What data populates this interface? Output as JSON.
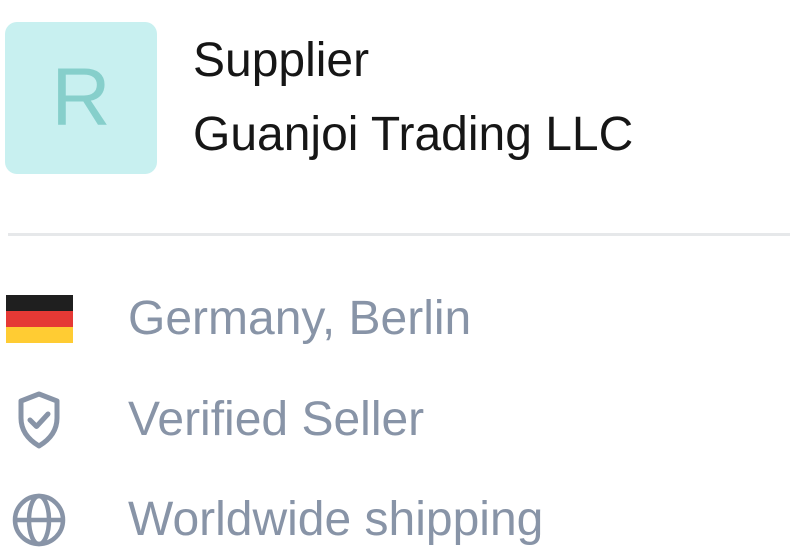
{
  "supplier": {
    "avatar_letter": "R",
    "label": "Supplier",
    "name": "Guanjoi Trading LLC"
  },
  "details": [
    {
      "icon": "germany-flag-icon",
      "text": "Germany, Berlin"
    },
    {
      "icon": "shield-check-icon",
      "text": "Verified Seller"
    },
    {
      "icon": "globe-icon",
      "text": "Worldwide shipping"
    }
  ],
  "colors": {
    "avatar_bg": "#c8f0f0",
    "avatar_letter": "#86cfcb",
    "muted_text": "#8894a7",
    "primary_text": "#161616",
    "divider": "#e6e8ea",
    "flag_black": "#1f1f1f",
    "flag_red": "#e53935",
    "flag_gold": "#ffcc33"
  }
}
